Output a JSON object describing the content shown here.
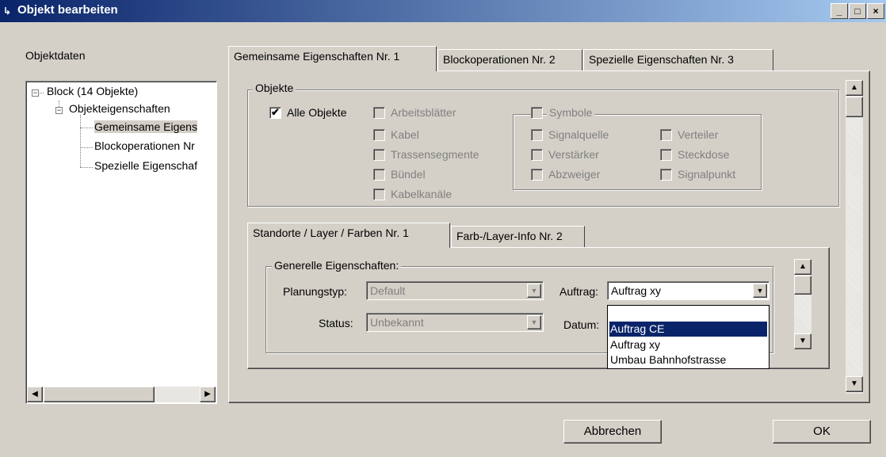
{
  "window": {
    "title": "Objekt bearbeiten",
    "app_icon": "↳",
    "minimize": "_",
    "maximize": "□",
    "close": "×"
  },
  "left": {
    "title": "Objektdaten",
    "tree": [
      {
        "label": "Block (14 Objekte)"
      },
      {
        "label": "Objekteigenschaften"
      },
      {
        "label": "Gemeinsame Eigens"
      },
      {
        "label": "Blockoperationen Nr"
      },
      {
        "label": "Spezielle Eigenschaf"
      }
    ]
  },
  "tabs": [
    {
      "label": "Gemeinsame Eigenschaften Nr. 1"
    },
    {
      "label": "Blockoperationen Nr. 2"
    },
    {
      "label": "Spezielle Eigenschaften Nr. 3"
    }
  ],
  "objekte": {
    "title": "Objekte",
    "alle": {
      "label": "Alle Objekte",
      "checked": true
    },
    "col1": [
      "Arbeitsblätter",
      "Kabel",
      "Trassensegmente",
      "Bündel",
      "Kabelkanäle"
    ],
    "symbole": {
      "title": "Symbole",
      "col1": [
        "Signalquelle",
        "Verstärker",
        "Abzweiger"
      ],
      "col2": [
        "Verteiler",
        "Steckdose",
        "Signalpunkt"
      ]
    }
  },
  "subtabs": [
    {
      "label": "Standorte / Layer / Farben Nr. 1"
    },
    {
      "label": "Farb-/Layer-Info Nr. 2"
    }
  ],
  "generelle": {
    "title": "Generelle Eigenschaften:",
    "planungstyp_label": "Planungstyp:",
    "planungstyp_value": "Default",
    "status_label": "Status:",
    "status_value": "Unbekannt",
    "auftrag_label": "Auftrag:",
    "auftrag_value": "Auftrag xy",
    "datum_label": "Datum:",
    "auftrag_options": [
      "",
      "Auftrag CE",
      "Auftrag xy",
      "Umbau Bahnhofstrasse"
    ],
    "auftrag_highlighted": "Auftrag CE"
  },
  "buttons": {
    "cancel": "Abbrechen",
    "ok": "OK"
  }
}
